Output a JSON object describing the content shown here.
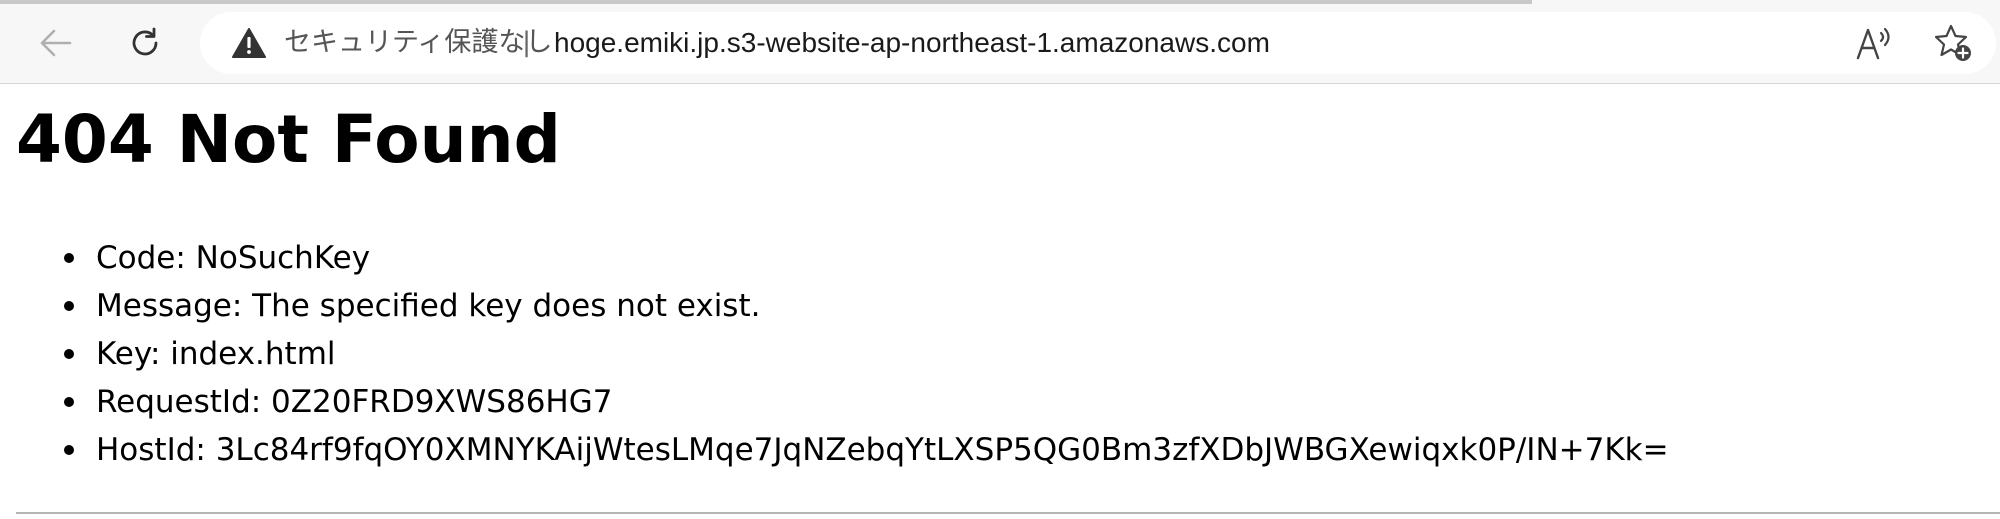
{
  "browser": {
    "back_icon": "back-arrow-icon",
    "refresh_icon": "refresh-icon",
    "security_icon": "warning-triangle-icon",
    "security_label": "セキュリティ保護なし",
    "separator": "|",
    "url": "hoge.emiki.jp.s3-website-ap-northeast-1.amazonaws.com",
    "read_aloud_icon": "read-aloud-icon",
    "favorite_icon": "add-favorite-star-icon"
  },
  "page": {
    "title": "404 Not Found",
    "items": [
      {
        "label": "Code: NoSuchKey"
      },
      {
        "label": "Message: The specified key does not exist."
      },
      {
        "label": "Key: index.html"
      },
      {
        "label": "RequestId: 0Z20FRD9XWS86HG7"
      },
      {
        "label": "HostId: 3Lc84rf9fqOY0XMNYKAijWtesLMqe7JqNZebqYtLXSP5QG0Bm3zfXDbJWBGXewiqxk0P/IN+7Kk="
      }
    ]
  }
}
